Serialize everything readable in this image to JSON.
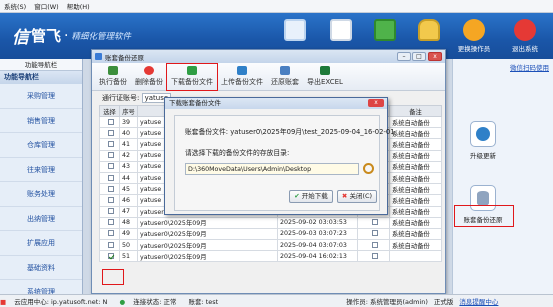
{
  "menu": [
    "系统(S)",
    "窗口(W)",
    "帮助(H)"
  ],
  "brand": {
    "mark": "信",
    "name": "管飞",
    "dot": "·",
    "slogan": "精细化管理软件"
  },
  "header_buttons": [
    {
      "label": "更换操作员",
      "icon": "user-icon"
    },
    {
      "label": "退出系统",
      "icon": "close-icon"
    }
  ],
  "sidebar": {
    "head": "功能导航栏",
    "title": "功能导航栏",
    "items": [
      "采购管理",
      "销售管理",
      "仓库管理",
      "往来管理",
      "账务处理",
      "出纳管理",
      "扩展应用",
      "基础资料",
      "系统管理"
    ]
  },
  "window": {
    "title": "账套备份还原",
    "toolbar": [
      "执行备份",
      "删除备份",
      "下载备份文件",
      "上传备份文件",
      "还原账套",
      "导出EXCEL"
    ],
    "query_label": "通行证账号:",
    "query_value": "yatuse",
    "columns": [
      "选择",
      "序号",
      "",
      "",
      "",
      "备注"
    ],
    "rows": [
      {
        "no": "39",
        "user": "yatuse",
        "time": "",
        "remark": "系统自动备份",
        "checked": false
      },
      {
        "no": "40",
        "user": "yatuse",
        "time": "",
        "remark": "系统自动备份",
        "checked": false
      },
      {
        "no": "41",
        "user": "yatuse",
        "time": "",
        "remark": "系统自动备份",
        "checked": false
      },
      {
        "no": "42",
        "user": "yatuse",
        "time": "",
        "remark": "系统自动备份",
        "checked": false
      },
      {
        "no": "43",
        "user": "yatuse",
        "time": "",
        "remark": "系统自动备份",
        "checked": false
      },
      {
        "no": "44",
        "user": "yatuse",
        "time": "",
        "remark": "系统自动备份",
        "checked": false
      },
      {
        "no": "45",
        "user": "yatuse",
        "time": "",
        "remark": "系统自动备份",
        "checked": false
      },
      {
        "no": "46",
        "user": "yatuse",
        "time": "",
        "remark": "系统自动备份",
        "checked": false
      },
      {
        "no": "47",
        "user": "yatuser0\\2025年09月",
        "time": "2025-09-01 03:10:45",
        "remark": "系统自动备份",
        "checked": false
      },
      {
        "no": "48",
        "user": "yatuser0\\2025年09月",
        "time": "2025-09-02 03:03:53",
        "remark": "系统自动备份",
        "checked": false
      },
      {
        "no": "49",
        "user": "yatuser0\\2025年09月",
        "time": "2025-09-03 03:07:23",
        "remark": "系统自动备份",
        "checked": false
      },
      {
        "no": "50",
        "user": "yatuser0\\2025年09月",
        "time": "2025-09-04 03:07:03",
        "remark": "系统自动备份",
        "checked": false
      },
      {
        "no": "51",
        "user": "yatuser0\\2025年09月",
        "time": "2025-09-04 16:02:13",
        "remark": "",
        "checked": true
      }
    ]
  },
  "dialog": {
    "title": "下载账套备份文件",
    "file_label": "账套备份文件: yatuser0\\2025年09月\\test_2025-09-04_16-02-01",
    "prompt": "请选择下载的备份文件的存放目录:",
    "path": "D:\\360MoveData\\Users\\Admin\\Desktop",
    "start": "开始下载",
    "close": "关闭(C)",
    "close_x": "x"
  },
  "right_panel": {
    "link": "微信扫码使用",
    "tiles": [
      "升级更新",
      "账套备份还原"
    ]
  },
  "status": {
    "cloud": "云应用中心: ip.yatusoft.net: N",
    "conn": "连接状态: 正常",
    "account": "账套: test",
    "operator": "操作员: 系统管理员(admin)",
    "edition": "正式版",
    "msg": "消息提醒中心"
  },
  "colors": {
    "header": "#1a56a8",
    "highlight": "#e0181b",
    "link": "#1b4fb8"
  }
}
